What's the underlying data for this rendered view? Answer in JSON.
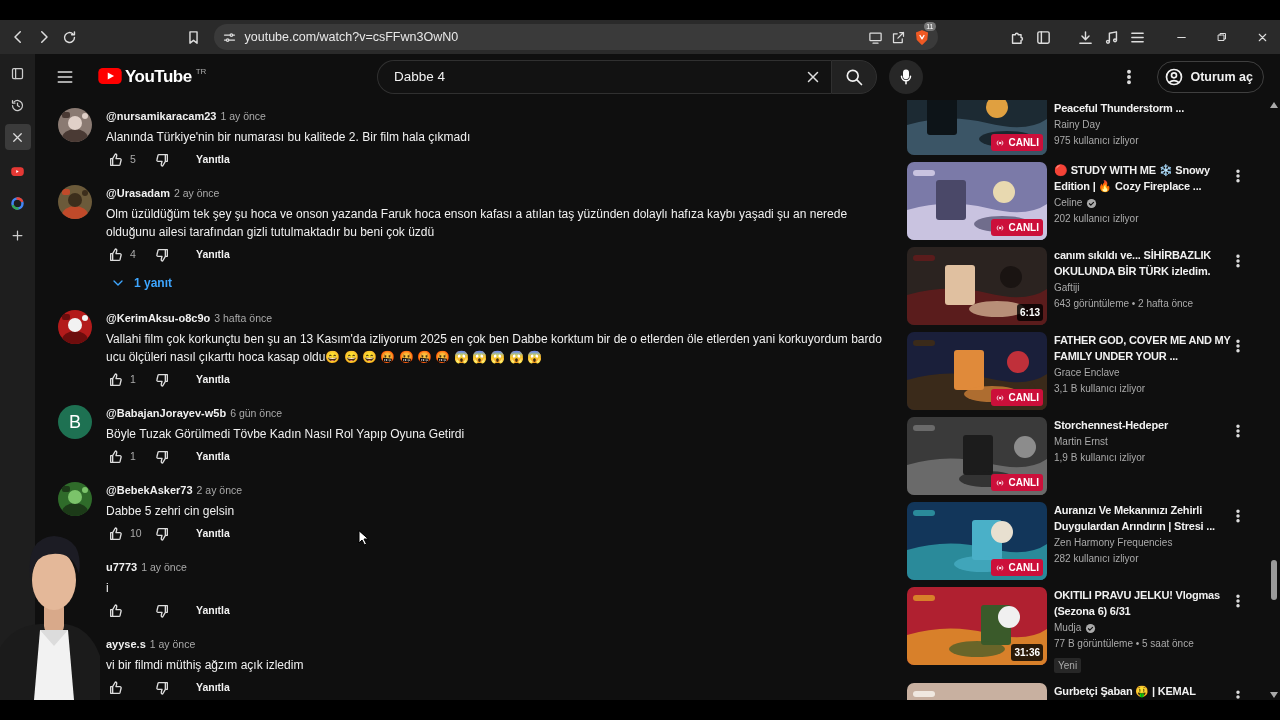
{
  "browser": {
    "url": "youtube.com/watch?v=csFFwn3OwN0",
    "shield_badge": "11"
  },
  "browser_sidebar": [
    {
      "kind": "panel",
      "selected": false
    },
    {
      "kind": "history",
      "selected": false
    },
    {
      "kind": "close",
      "selected": true
    },
    {
      "kind": "video",
      "selected": false
    },
    {
      "kind": "google",
      "selected": false
    },
    {
      "kind": "add",
      "selected": false
    }
  ],
  "masthead": {
    "logo": "YouTube",
    "region": "TR",
    "search": {
      "value": "Dabbe 4"
    },
    "sign_in": "Oturum aç"
  },
  "comments": [
    {
      "author": "@nursamikaracam23",
      "time": "1 ay önce",
      "text": "Alanında Türkiye'nin bir numarası bu kalitede 2. Bir film hala çıkmadı",
      "likes": "5",
      "reply": "Yanıtla"
    },
    {
      "author": "@Urasadam",
      "time": "2 ay önce",
      "text": "Olm üzüldüğüm tek şey şu hoca ve onson yazanda Faruk hoca enson kafası a atılan taş yüzünden dolaylı hafıza kaybı yaşadi şu an nerede olduğunu ailesi tarafından gizli tutulmaktadır bu beni çok üzdü",
      "likes": "4",
      "reply": "Yanıtla",
      "replies_toggle": "1 yanıt"
    },
    {
      "author": "@KerimAksu-o8c9o",
      "time": "3 hafta önce",
      "text": "Vallahi film çok korkunçtu ben şu an 13 Kasım'da izliyorum 2025 en çok ben Dabbe korktum bir de o etlerden öle etlerden yani korkuyordum bardo ucu ölçüleri nasıl çıkarttı hoca kasap oldu😄 😄 😄 🤬 🤬 🤬 🤬 😱 😱 😱 😱 😱",
      "likes": "1",
      "reply": "Yanıtla"
    },
    {
      "author": "@BabajanJorayev-w5b",
      "time": "6 gün önce",
      "text": "Böyle Tuzak Görülmedi Tövbe Kadın Nasıl Rol Yapıp Oyuna Getirdi",
      "likes": "1",
      "reply": "Yanıtla",
      "avatar": {
        "kind": "letter",
        "letter": "B",
        "color": "#1e7152"
      }
    },
    {
      "author": "@BebekAsker73",
      "time": "2 ay önce",
      "text": "Dabbe 5 zehri cin gelsin",
      "likes": "10",
      "reply": "Yanıtla"
    },
    {
      "author": "u7773",
      "time": "1 ay önce",
      "text": "i",
      "reply": "Yanıtla"
    },
    {
      "author": "ayyse.s",
      "time": "1 ay önce",
      "text": "vi bir filmdi müthiş ağzım açık izledim",
      "reply": "Yanıtla"
    }
  ],
  "up_next": [
    {
      "title": "Peaceful Thunderstorm ...",
      "channel": "Rainy Day",
      "verified": false,
      "meta": "975 kullanıcı izliyor",
      "badge": {
        "kind": "live",
        "label": "CANLI"
      }
    },
    {
      "title": "🔴 STUDY WITH ME ❄️ Snowy Edition | 🔥 Cozy Fireplace ...",
      "channel": "Celine",
      "verified": true,
      "meta": "202 kullanıcı izliyor",
      "badge": {
        "kind": "live",
        "label": "CANLI"
      }
    },
    {
      "title": "canım sıkıldı ve... SİHİRBAZLIK OKULUNDA BİR TÜRK izledim.",
      "channel": "Gaftiji",
      "verified": false,
      "meta": "643 görüntüleme • 2 hafta önce",
      "badge": {
        "kind": "duration",
        "label": "6:13"
      }
    },
    {
      "title": "FATHER GOD, COVER ME AND MY FAMILY UNDER YOUR ...",
      "channel": "Grace Enclave",
      "verified": false,
      "meta": "3,1 B kullanıcı izliyor",
      "badge": {
        "kind": "live",
        "label": "CANLI"
      }
    },
    {
      "title": "Storchennest-Hedeper",
      "channel": "Martin Ernst",
      "verified": false,
      "meta": "1,9 B kullanıcı izliyor",
      "badge": {
        "kind": "live",
        "label": "CANLI"
      }
    },
    {
      "title": "Auranızı Ve Mekanınızı Zehirli Duygulardan Arındırın | Stresi ...",
      "channel": "Zen Harmony Frequencies",
      "verified": false,
      "meta": "282 kullanıcı izliyor",
      "badge": {
        "kind": "live",
        "label": "CANLI"
      }
    },
    {
      "title": "OKITILI PRAVU JELKU! Vlogmas (Sezona 6) 6/31",
      "channel": "Mudja",
      "verified": true,
      "meta": "77 B görüntüleme • 5 saat önce",
      "badge": {
        "kind": "duration",
        "label": "31:36"
      },
      "tag": "Yeni"
    },
    {
      "title": "Gurbetçi Şaban 🤑 | KEMAL"
    }
  ]
}
